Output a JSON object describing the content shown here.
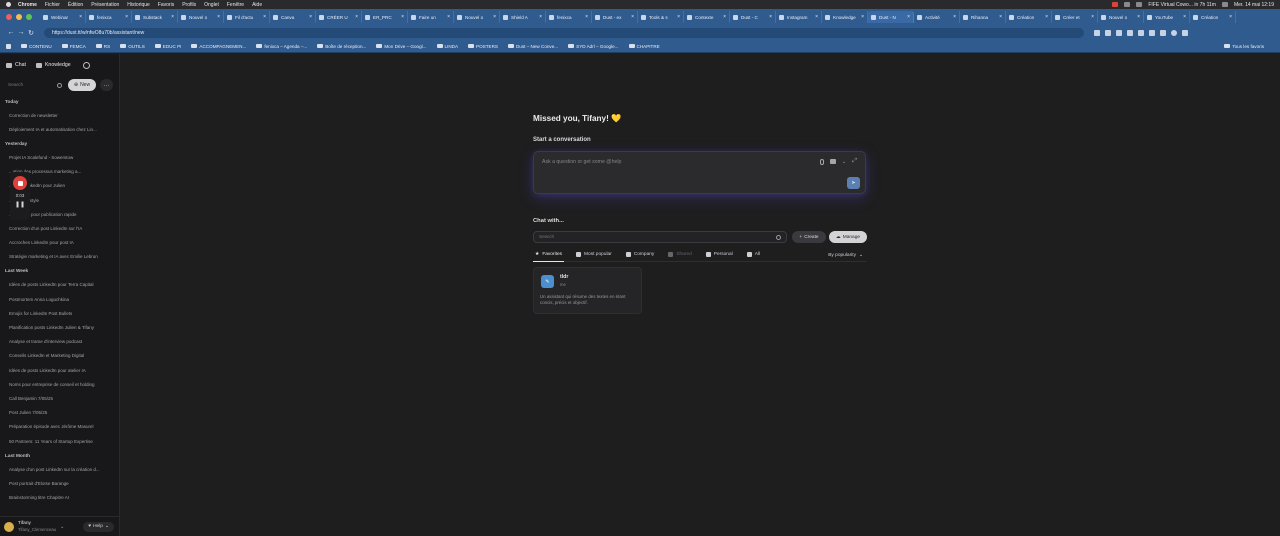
{
  "menubar": {
    "app": "Chrome",
    "items": [
      "Fichier",
      "Édition",
      "Présentation",
      "Historique",
      "Favoris",
      "Profils",
      "Onglet",
      "Fenêtre",
      "Aide"
    ],
    "status": "FIFE Virtual Cowo... in 7h 11m",
    "clock": "Mer. 14 mai 12:19"
  },
  "tabs": [
    {
      "label": "Webinar"
    },
    {
      "label": "fenixca"
    },
    {
      "label": "Substack"
    },
    {
      "label": "Nouvel o"
    },
    {
      "label": "Fil d'actu"
    },
    {
      "label": "Canva"
    },
    {
      "label": "CRÉER U"
    },
    {
      "label": "ER_PRC"
    },
    {
      "label": "Faire un"
    },
    {
      "label": "Nouvel o"
    },
    {
      "label": "Shield A"
    },
    {
      "label": "fenixca"
    },
    {
      "label": "Dust - ex"
    },
    {
      "label": "Tools & s"
    },
    {
      "label": "Contexte"
    },
    {
      "label": "Dust - C"
    },
    {
      "label": "Instagram"
    },
    {
      "label": "Knowledge"
    },
    {
      "label": "Dust - N"
    },
    {
      "label": "Activité"
    },
    {
      "label": "Rihanna"
    },
    {
      "label": "Création"
    },
    {
      "label": "Créer et"
    },
    {
      "label": "Nouvel o"
    },
    {
      "label": "YouTube"
    },
    {
      "label": "Création"
    }
  ],
  "address": {
    "url": "https://dust.tt/w/nfwO8u70b/assistant/new"
  },
  "bookmarks": [
    {
      "label": "CONTENU"
    },
    {
      "label": "FEMCA"
    },
    {
      "label": "RS"
    },
    {
      "label": "OUTILS"
    },
    {
      "label": "EDUC PI"
    },
    {
      "label": "ACCOMPAGNEMEN..."
    },
    {
      "label": "fenixca – Agenda –..."
    },
    {
      "label": "Boîte de réception..."
    },
    {
      "label": "Mon Drive – Googl..."
    },
    {
      "label": "LINDA"
    },
    {
      "label": "POSTERS"
    },
    {
      "label": "Dust – New Conve..."
    },
    {
      "label": "SYD Adrl – Google..."
    },
    {
      "label": "CHAPITRE"
    }
  ],
  "bookmarks_end": "Tous les favoris",
  "sidebar": {
    "tab_chat": "Chat",
    "tab_knowledge": "Knowledge",
    "search_placeholder": "Search",
    "new_label": "New",
    "more_label": "…",
    "sections": [
      {
        "title": "Today",
        "items": [
          "Correction de newsletter",
          "Déploiement IA et automatisation chez Lin..."
        ]
      },
      {
        "title": "Yesterday",
        "items": [
          "Projet IA Scalefund - Sowerstow",
          "...ation des processus marketing a...",
          "...posts LinkedIn pour Julien",
          "...ligne de style",
          "...LinkedIn pour publication rapide",
          "Correction d'un post LinkedIn sur l'IA",
          "Accroches LinkedIn pour post IA",
          "Stratégie marketing et IA avec Emilie Lebrun"
        ]
      },
      {
        "title": "Last Week",
        "items": [
          "Idées de posts LinkedIn pour Terra Capital",
          "Postmortem Anna Loguchkina",
          "Emojis for LinkedIn Post Bullets",
          "Planification posts LinkedIn Julien & Tifany",
          "Analyse et trame d'interview podcast",
          "Conseils LinkedIn et Marketing Digital",
          "Idées de posts LinkedIn pour atelier IA",
          "Noms pour entreprise de conseil et holding",
          "Call Benjamin 7/05/25",
          "Post Julien 7/05/25",
          "Préparation épisode avec Jérôme Masurel",
          "50 Partners: 11 Years of Startup Expertise"
        ]
      },
      {
        "title": "Last Month",
        "items": [
          "Analyse d'un post LinkedIn sur la création d...",
          "Post portrait d'Eloïse Barange",
          "Brainstorming titre Chapitre AI"
        ]
      }
    ],
    "user": {
      "name": "Tifany",
      "handle": "Tifany_Clemenceau"
    },
    "help_label": "Help"
  },
  "recorder": {
    "time": "0:03"
  },
  "main": {
    "greeting": "Missed you, Tifany! 💛",
    "start_label": "Start a conversation",
    "composer_placeholder": "Ask a question or get some @help",
    "chat_with_label": "Chat with...",
    "agent_search_placeholder": "Search",
    "create_label": "Create",
    "manage_label": "Manage",
    "filters": [
      {
        "label": "Favorites",
        "state": "active"
      },
      {
        "label": "Most popular",
        "state": "normal"
      },
      {
        "label": "Company",
        "state": "normal"
      },
      {
        "label": "Shared",
        "state": "disabled"
      },
      {
        "label": "Personal",
        "state": "normal"
      },
      {
        "label": "All",
        "state": "normal"
      }
    ],
    "sort_label": "By popularity",
    "agent_card": {
      "name": "tldr",
      "author": "me",
      "description": "Un assistant qui résume des textes en étant concis, précis et objectif."
    }
  },
  "colors": {
    "browser_chrome": "#2f5b8f",
    "sidebar_bg": "#18181a",
    "main_bg": "#1e1e1f",
    "record_red": "#e0413a",
    "send_button": "#5c7fb1",
    "avatar_yellow": "#d7b04a"
  }
}
